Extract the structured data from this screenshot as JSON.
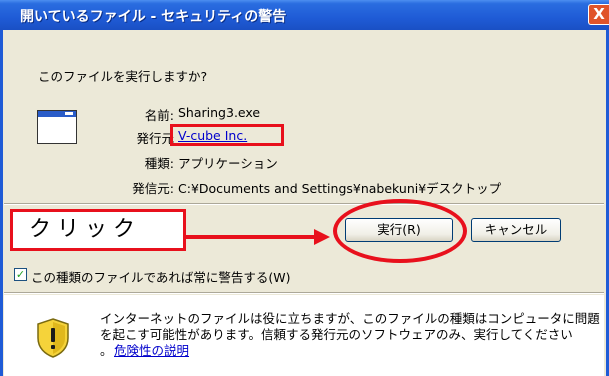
{
  "window": {
    "title": "開いているファイル - セキュリティの警告",
    "close_glyph": "X"
  },
  "prompt": {
    "question": "このファイルを実行しますか?"
  },
  "file_info": {
    "icon": "application-window-icon",
    "name_label": "名前:",
    "name_value": "Sharing3.exe",
    "publisher_label": "発行元",
    "publisher_value": "V-cube Inc.",
    "type_label": "種類:",
    "type_value": "アプリケーション",
    "source_label": "発信元:",
    "source_value": "C:¥Documents and Settings¥nabekuni¥デスクトップ"
  },
  "buttons": {
    "run_label": "実行(R)",
    "cancel_label": "キャンセル"
  },
  "annotation": {
    "click_label": "クリック",
    "color": "#e8101c"
  },
  "checkbox": {
    "label": "この種類のファイルであれば常に警告する(W)",
    "checked": true,
    "check_glyph": "✓"
  },
  "warning": {
    "icon": "warning-shield-icon",
    "line1": "インターネットのファイルは役に立ちますが、このファイルの種類はコンピュータに問題",
    "line2": "を起こす可能性があります。信頼する発行元のソフトウェアのみ、実行してください",
    "bullet": "。",
    "risk_link": "危険性の説明"
  },
  "colors": {
    "titlebar": "#1f5bd6",
    "dialog_bg": "#ece9d8",
    "link": "#0000cc",
    "highlight": "#e8101c"
  }
}
